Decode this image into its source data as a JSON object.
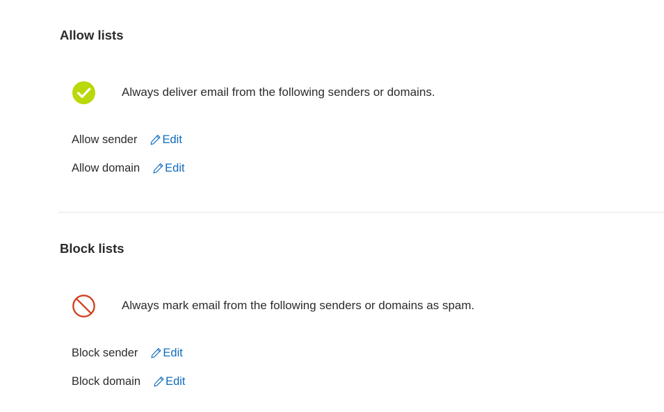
{
  "allow": {
    "title": "Allow lists",
    "description": "Always deliver email from the following senders or domains.",
    "icon": "check-circle-icon",
    "icon_color": "#bad80a",
    "rows": [
      {
        "label": "Allow sender",
        "edit_label": "Edit"
      },
      {
        "label": "Allow domain",
        "edit_label": "Edit"
      }
    ]
  },
  "block": {
    "title": "Block lists",
    "description": "Always mark email from the following senders or domains as spam.",
    "icon": "blocked-icon",
    "icon_color": "#d13f1c",
    "rows": [
      {
        "label": "Block sender",
        "edit_label": "Edit"
      },
      {
        "label": "Block domain",
        "edit_label": "Edit"
      }
    ]
  },
  "colors": {
    "link": "#0f6cbd",
    "text": "#2b2b2b",
    "divider": "#e6e6e6"
  }
}
